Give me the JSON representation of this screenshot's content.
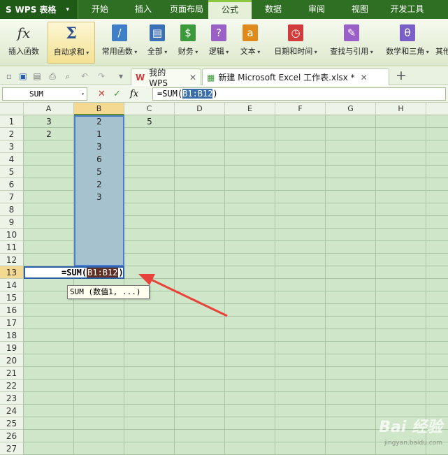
{
  "app": {
    "name": "WPS 表格"
  },
  "menu": [
    "开始",
    "插入",
    "页面布局",
    "公式",
    "数据",
    "审阅",
    "视图",
    "开发工具"
  ],
  "menu_active": "公式",
  "ribbon": [
    {
      "label": "插入函数",
      "icon": "function-fx-icon",
      "color": "#333333"
    },
    {
      "label": "自动求和",
      "icon": "sigma-icon",
      "color": "#2a4f8a"
    },
    {
      "label": "常用函数",
      "icon": "common-function-icon",
      "color": "#3e7fc7"
    },
    {
      "label": "全部",
      "icon": "all-functions-icon",
      "color": "#3b6fb6"
    },
    {
      "label": "财务",
      "icon": "finance-icon",
      "color": "#3c9a3c"
    },
    {
      "label": "逻辑",
      "icon": "logic-icon",
      "color": "#9b5fc8"
    },
    {
      "label": "文本",
      "icon": "text-icon",
      "color": "#e08a1c"
    },
    {
      "label": "日期和时间",
      "icon": "datetime-icon",
      "color": "#d23b3b"
    },
    {
      "label": "查找与引用",
      "icon": "lookup-icon",
      "color": "#9b5fc8"
    },
    {
      "label": "数学和三角",
      "icon": "math-icon",
      "color": "#7a5fc8"
    },
    {
      "label": "其他"
    }
  ],
  "tabs": {
    "home": "我的WPS",
    "doc": "新建 Microsoft Excel 工作表.xlsx *"
  },
  "formula_bar": {
    "name_box": "SUM",
    "prefix": "=SUM(",
    "ref": "B1:B12",
    "suffix": ")"
  },
  "columns": [
    "A",
    "B",
    "C",
    "D",
    "E",
    "F",
    "G",
    "H"
  ],
  "rows": [
    "1",
    "2",
    "3",
    "4",
    "5",
    "6",
    "7",
    "8",
    "9",
    "10",
    "11",
    "12",
    "13",
    "14",
    "15",
    "16",
    "17",
    "18",
    "19",
    "20",
    "21",
    "22",
    "23",
    "24",
    "25",
    "26",
    "27"
  ],
  "cells": {
    "A1": "3",
    "A2": "2",
    "C1": "5",
    "B": [
      "2",
      "1",
      "3",
      "6",
      "5",
      "2",
      "3"
    ]
  },
  "edit": {
    "prefix": "=SUM(",
    "ref": "B1:B12",
    "suffix": ")"
  },
  "tooltip": "SUM (数值1, ...)",
  "watermark": {
    "main": "Bai 经验",
    "sub": "jingyan.baidu.com"
  },
  "colors": {
    "menubar": "#2f6f23",
    "grid_bg": "#cfe6c9",
    "selection": "#a6c2cf",
    "arrow": "#e8433a"
  }
}
